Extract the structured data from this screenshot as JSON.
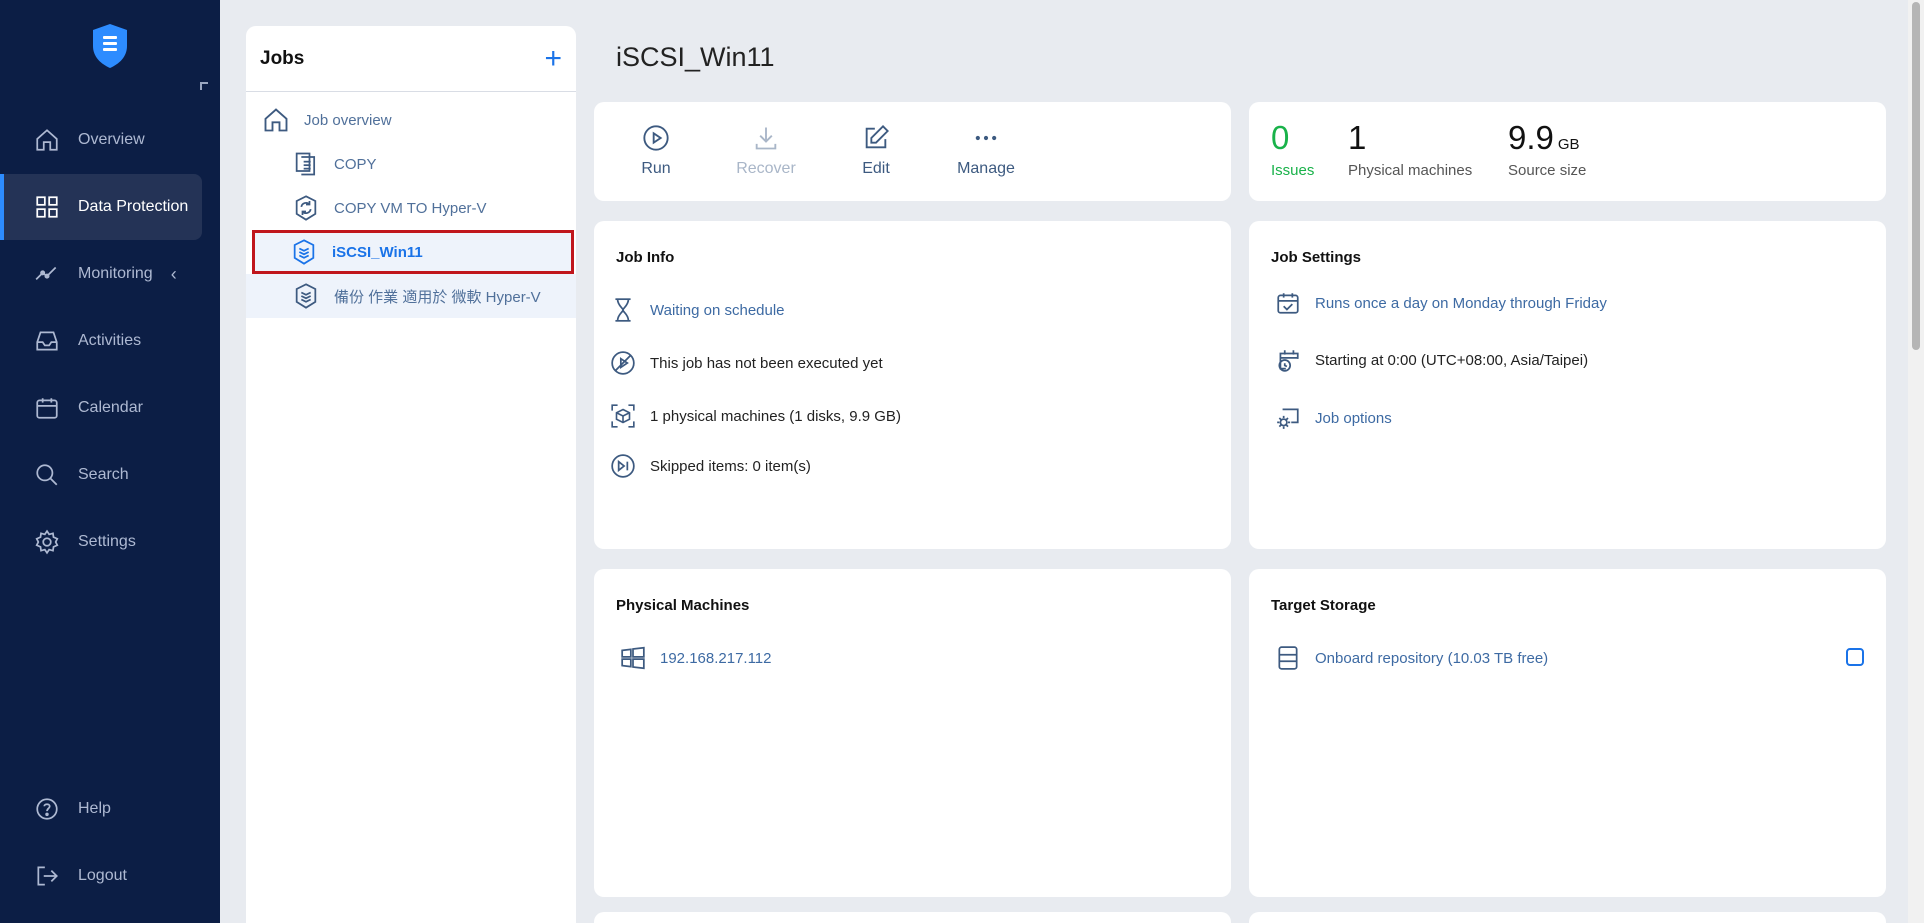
{
  "sidebar": {
    "items": [
      {
        "label": "Overview",
        "icon": "home-icon"
      },
      {
        "label": "Data Protection",
        "icon": "grid-icon"
      },
      {
        "label": "Monitoring",
        "icon": "chart-line-icon"
      },
      {
        "label": "Activities",
        "icon": "inbox-icon"
      },
      {
        "label": "Calendar",
        "icon": "calendar-icon"
      },
      {
        "label": "Search",
        "icon": "search-icon"
      },
      {
        "label": "Settings",
        "icon": "gear-icon"
      }
    ],
    "bottom": [
      {
        "label": "Help",
        "icon": "help-icon"
      },
      {
        "label": "Logout",
        "icon": "logout-icon"
      }
    ]
  },
  "jobs": {
    "title": "Jobs",
    "add_label": "+",
    "overview_label": "Job overview",
    "items": [
      {
        "label": "COPY",
        "icon": "copy-job-icon"
      },
      {
        "label": "COPY VM TO Hyper-V",
        "icon": "replication-job-icon"
      },
      {
        "label": "iSCSI_Win11",
        "icon": "backup-job-icon",
        "selected": true
      },
      {
        "label": "備份 作業 適用於 微軟 Hyper-V",
        "icon": "backup-job-icon"
      }
    ]
  },
  "main": {
    "title": "iSCSI_Win11",
    "actions": [
      {
        "label": "Run",
        "icon": "play-circle-icon"
      },
      {
        "label": "Recover",
        "icon": "download-icon",
        "disabled": true
      },
      {
        "label": "Edit",
        "icon": "edit-icon"
      },
      {
        "label": "Manage",
        "icon": "more-icon"
      }
    ],
    "stats": {
      "issues": {
        "value": "0",
        "label": "Issues"
      },
      "machines": {
        "value": "1",
        "label": "Physical machines"
      },
      "size": {
        "value": "9.9",
        "unit": "GB",
        "label": "Source size"
      }
    },
    "job_info": {
      "title": "Job Info",
      "status": "Waiting on schedule",
      "last_run": "This job has not been executed yet",
      "machines": "1 physical machines (1 disks, 9.9 GB)",
      "skipped": "Skipped items: 0 item(s)"
    },
    "job_settings": {
      "title": "Job Settings",
      "schedule": "Runs once a day on Monday through Friday",
      "start": "Starting at 0:00 (UTC+08:00, Asia/Taipei)",
      "options": "Job options"
    },
    "physical_machines": {
      "title": "Physical Machines",
      "items": [
        "192.168.217.112"
      ]
    },
    "target_storage": {
      "title": "Target Storage",
      "repository": "Onboard repository (10.03 TB free)"
    }
  },
  "colors": {
    "sidebar_bg": "#0c1e45",
    "accent": "#1a73e8",
    "issues_green": "#19b24a",
    "selection_border": "#c0161c"
  }
}
